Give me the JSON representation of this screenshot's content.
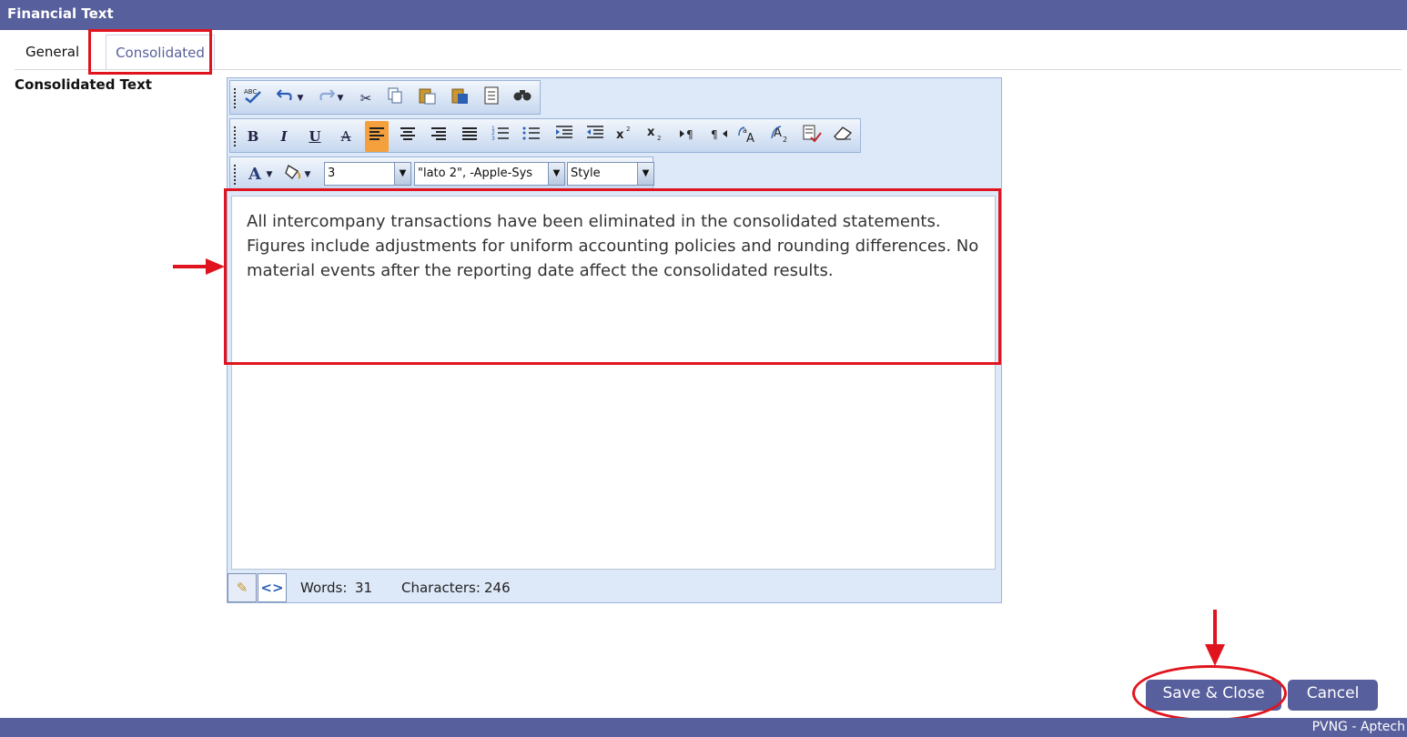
{
  "window": {
    "title": "Financial Text"
  },
  "tabs": [
    {
      "label": "General"
    },
    {
      "label": "Consolidated"
    }
  ],
  "field": {
    "label": "Consolidated Text"
  },
  "toolbar": {
    "font_size": "3",
    "font_family": "\"lato 2\", -Apple-Sys",
    "style": "Style",
    "bold": "B",
    "italic": "I",
    "underline": "U",
    "strike": "A",
    "font_color": "A"
  },
  "editor": {
    "content": "All intercompany transactions have been eliminated in the consolidated statements. Figures include adjustments for uniform accounting policies and rounding differences. No material events after the reporting date affect the consolidated results.",
    "words_label": "Words:",
    "words_value": "31",
    "chars_label": "Characters:",
    "chars_value": "246"
  },
  "buttons": {
    "save": "Save & Close",
    "cancel": "Cancel"
  },
  "footer": {
    "text": "PVNG - Aptech"
  },
  "colors": {
    "brand": "#575f9c",
    "highlight": "#e0141e",
    "active_tool": "#f4a03c"
  }
}
